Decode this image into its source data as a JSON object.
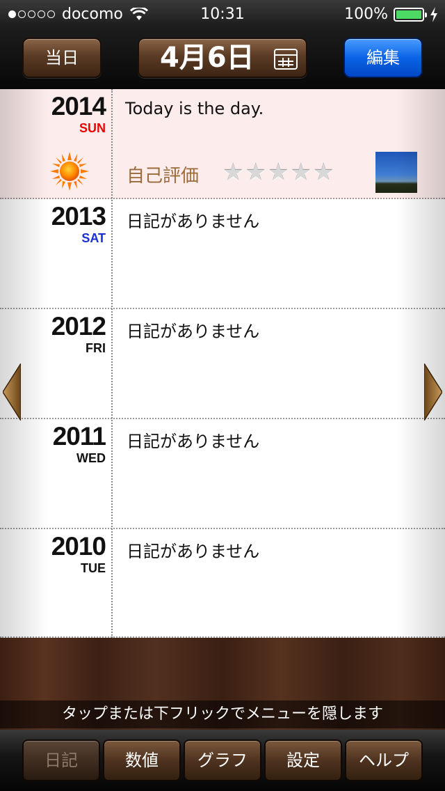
{
  "status": {
    "carrier": "docomo",
    "time": "10:31",
    "battery": "100%",
    "signal_filled": 1,
    "signal_total": 5
  },
  "nav": {
    "today_label": "当日",
    "date_label": "4月6日",
    "edit_label": "編集"
  },
  "entries": [
    {
      "year": "2014",
      "dow": "SUN",
      "text": "Today is the day.",
      "rating_label": "自己評価",
      "rating": 0,
      "weather": "sunny-icon"
    },
    {
      "year": "2013",
      "dow": "SAT",
      "text": "日記がありません"
    },
    {
      "year": "2012",
      "dow": "FRI",
      "text": "日記がありません"
    },
    {
      "year": "2011",
      "dow": "WED",
      "text": "日記がありません"
    },
    {
      "year": "2010",
      "dow": "TUE",
      "text": "日記がありません"
    }
  ],
  "hint": "タップまたは下フリックでメニューを隠します",
  "tabs": [
    "日記",
    "数値",
    "グラフ",
    "設定",
    "ヘルプ"
  ],
  "colors": {
    "edit_blue": "#0b63e5",
    "today_bg": "#fdecec",
    "sun_red": "#ee0000",
    "sat_blue": "#1b2fd6",
    "eval_brown": "#9b6a3a"
  }
}
